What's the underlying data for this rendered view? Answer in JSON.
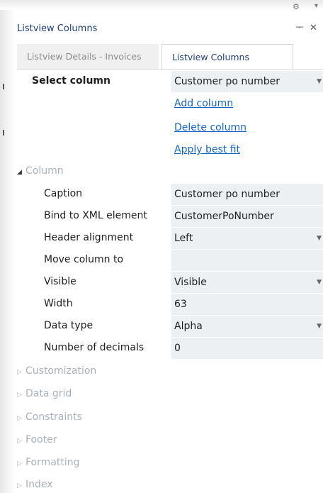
{
  "window": {
    "title": "Listview Columns",
    "pin_icon": "pin-icon",
    "close_icon": "close-icon",
    "gear_icon": "gear-icon"
  },
  "tabs": [
    {
      "label": "Listview Details - Invoices",
      "active": false
    },
    {
      "label": "Listview Columns",
      "active": true
    }
  ],
  "select_column": {
    "label": "Select column",
    "value": "Customer po number"
  },
  "links": {
    "add": "Add column",
    "delete": "Delete column",
    "best_fit": "Apply best fit"
  },
  "column_group": {
    "label": "Column",
    "properties": [
      {
        "label": "Caption",
        "value": "Customer po number",
        "dropdown": false
      },
      {
        "label": "Bind to XML element",
        "value": "CustomerPoNumber",
        "dropdown": false
      },
      {
        "label": "Header alignment",
        "value": "Left",
        "dropdown": true
      },
      {
        "label": "Move column to",
        "value": "",
        "dropdown": false
      },
      {
        "label": "Visible",
        "value": "Visible",
        "dropdown": true
      },
      {
        "label": "Width",
        "value": "63",
        "dropdown": false
      },
      {
        "label": "Data type",
        "value": "Alpha",
        "dropdown": true
      },
      {
        "label": "Number of decimals",
        "value": "0",
        "dropdown": false
      }
    ]
  },
  "collapsed_groups": [
    "Customization",
    "Data grid",
    "Constraints",
    "Footer",
    "Formatting",
    "Index"
  ],
  "colors": {
    "link": "#1565c0",
    "title": "#1f3e7a",
    "field_bg": "#ecf0f3",
    "group_text": "#a9b1bb"
  }
}
